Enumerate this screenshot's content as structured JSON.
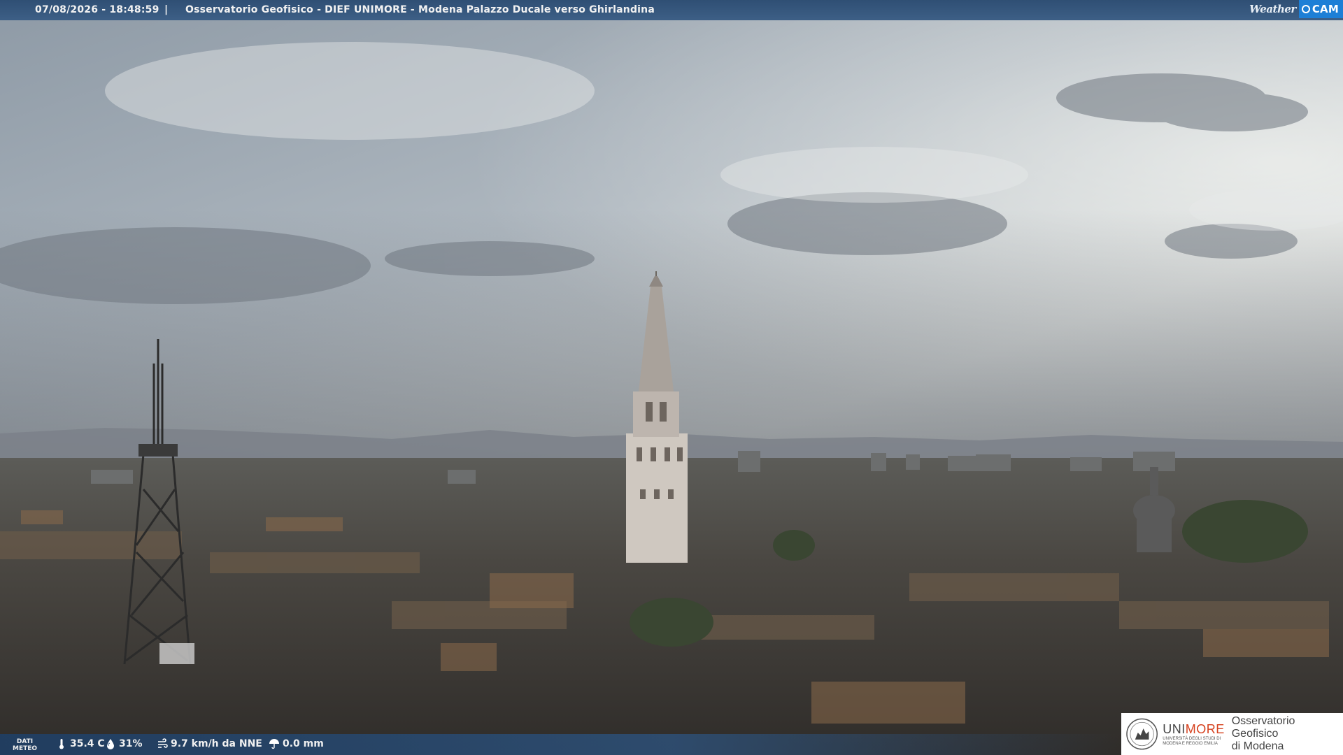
{
  "header": {
    "timestamp": "07/08/2026 - 18:48:59",
    "separator": "|",
    "title": "Osservatorio Geofisico - DIEF UNIMORE - Modena Palazzo Ducale verso Ghirlandina"
  },
  "weathercam_logo": {
    "word": "Weather",
    "cam": "CAM"
  },
  "weather": {
    "label_line1": "DATI",
    "label_line2": "METEO",
    "temperature": "35.4 C",
    "humidity": "31%",
    "wind": "9.7 km/h da NNE",
    "rain": "0.0 mm",
    "icons": [
      "thermometer-icon",
      "humidity-drop-icon",
      "wind-icon",
      "rain-umbrella-icon"
    ]
  },
  "unimore": {
    "brand_uni": "UNI",
    "brand_more": "MORE",
    "brand_subtitle_1": "UNIVERSITÀ DEGLI STUDI DI",
    "brand_subtitle_2": "MODENA E REGGIO EMILIA",
    "observatory_line1": "Osservatorio Geofisico",
    "observatory_line2": "di Modena"
  },
  "colors": {
    "bar": "#2f4f74",
    "accent_more": "#d6411e",
    "wc_blue": "#1d7fd6"
  }
}
